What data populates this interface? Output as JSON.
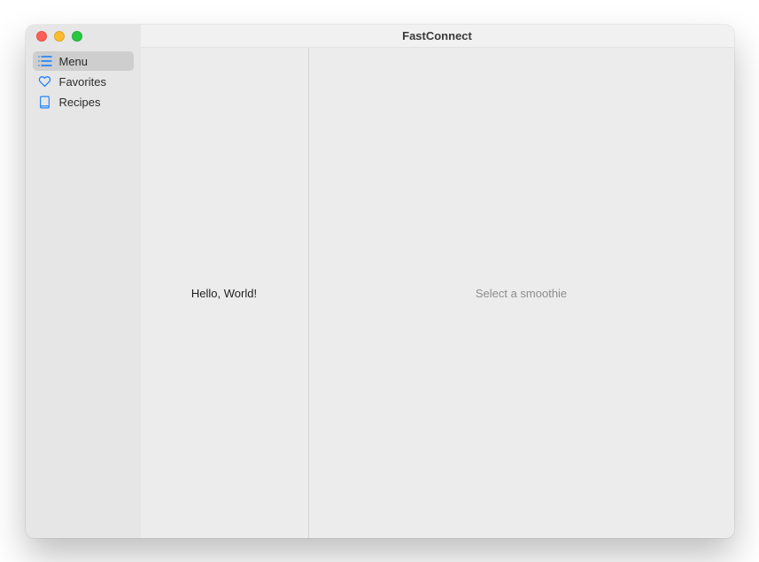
{
  "window": {
    "title": "FastConnect"
  },
  "sidebar": {
    "items": [
      {
        "label": "Menu",
        "icon": "list-icon",
        "selected": true
      },
      {
        "label": "Favorites",
        "icon": "heart-icon",
        "selected": false
      },
      {
        "label": "Recipes",
        "icon": "book-icon",
        "selected": false
      }
    ]
  },
  "secondary_pane": {
    "text": "Hello, World!"
  },
  "detail_pane": {
    "placeholder": "Select a smoothie"
  },
  "colors": {
    "accent": "#0a7aff"
  }
}
